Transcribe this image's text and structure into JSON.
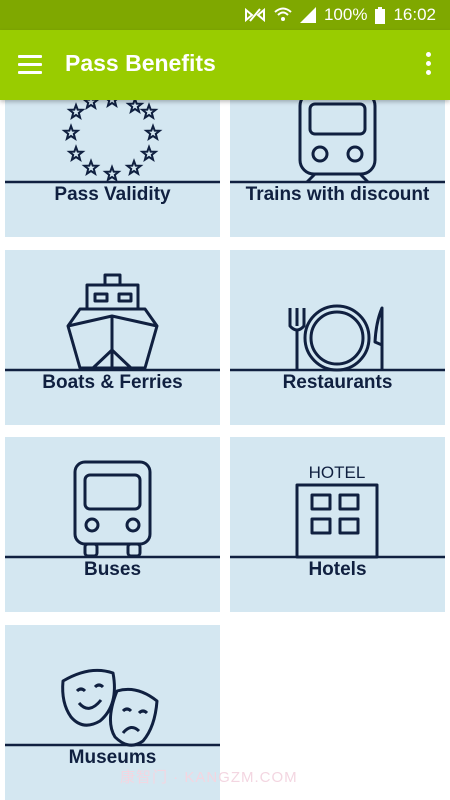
{
  "status_bar": {
    "battery": "100%",
    "time": "16:02",
    "icons": [
      "nfc-icon",
      "wifi-icon",
      "signal-icon",
      "battery-icon"
    ]
  },
  "app_bar": {
    "title": "Pass Benefits",
    "menu_icon": "hamburger-menu-icon",
    "overflow_icon": "more-vert-icon"
  },
  "tiles": [
    {
      "label": "Pass Validity",
      "icon": "eu-stars-icon"
    },
    {
      "label": "Trains with discount",
      "icon": "train-icon"
    },
    {
      "label": "Boats & Ferries",
      "icon": "ship-icon"
    },
    {
      "label": "Restaurants",
      "icon": "cutlery-icon"
    },
    {
      "label": "Buses",
      "icon": "bus-icon"
    },
    {
      "label": "Hotels",
      "icon": "hotel-icon",
      "icon_text": "HOTEL"
    },
    {
      "label": "Museums",
      "icon": "theater-masks-icon"
    }
  ],
  "watermark": "康智门 · KANGZM.COM",
  "colors": {
    "status_bar": "#7fa800",
    "app_bar": "#99cc00",
    "tile_background": "#d4e7f1",
    "icon_stroke": "#102040"
  }
}
